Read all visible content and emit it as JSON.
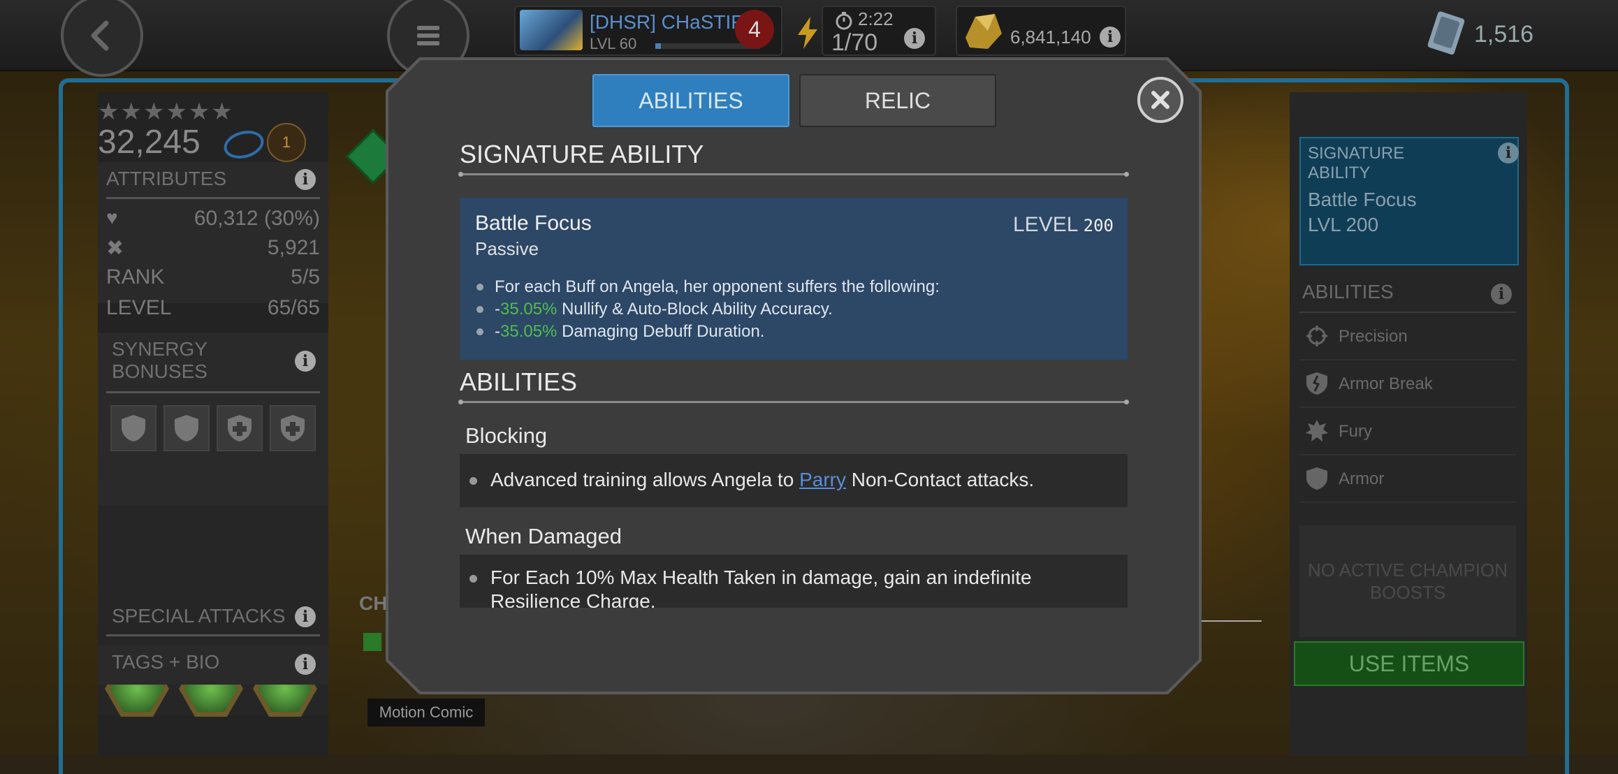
{
  "topbar": {
    "player_name": "[DHSR] CHaSTIF°",
    "player_level": "LVL 60",
    "xp_progress": 0.05,
    "notifications": "4",
    "energy_timer": "2:22",
    "energy_count": "1/70",
    "gold": "6,841,140",
    "units": "1,516"
  },
  "champion": {
    "stars": "★★★★★★",
    "rating": "32,245",
    "rank_badge": "1",
    "attributes_header": "ATTRIBUTES",
    "health": "60,312",
    "health_pct": "30%",
    "attack": "5,921",
    "rank_label": "RANK",
    "rank_value": "5/5",
    "level_label": "LEVEL",
    "level_value": "65/65",
    "synergy_header": "SYNERGY BONUSES",
    "special_attacks_header": "SPECIAL ATTACKS",
    "tags_header": "TAGS + BIO",
    "cha_label": "CHA",
    "motion_comic": "Motion Comic"
  },
  "right_panel": {
    "sig_title": "SIGNATURE ABILITY",
    "sig_name": "Battle Focus",
    "sig_level": "LVL 200",
    "abilities_header": "ABILITIES",
    "items": [
      {
        "label": "Precision",
        "icon": "crosshair-icon"
      },
      {
        "label": "Armor Break",
        "icon": "broken-shield-icon"
      },
      {
        "label": "Fury",
        "icon": "fury-icon"
      },
      {
        "label": "Armor",
        "icon": "shield-icon"
      }
    ],
    "no_boosts": "NO ACTIVE CHAMPION BOOSTS",
    "use_items": "USE ITEMS"
  },
  "modal": {
    "tabs": [
      {
        "label": "ABILITIES",
        "active": true
      },
      {
        "label": "RELIC",
        "active": false
      }
    ],
    "signature_header": "SIGNATURE ABILITY",
    "signature": {
      "name": "Battle Focus",
      "type": "Passive",
      "level_label": "LEVEL",
      "level_value": "200",
      "line1": "For each Buff on Angela, her opponent suffers the following:",
      "line2_prefix": "-",
      "line2_value": "35.05%",
      "line2_text": " Nullify & Auto-Block Ability Accuracy.",
      "line3_prefix": "-",
      "line3_value": "35.05%",
      "line3_text": " Damaging Debuff Duration."
    },
    "abilities_header": "ABILITIES",
    "blocking_title": "Blocking",
    "blocking_pre": "Advanced training allows Angela to ",
    "blocking_link": "Parry",
    "blocking_post": " Non-Contact attacks.",
    "damaged_title": "When Damaged",
    "damaged_line1": "For Each 10% Max Health Taken in damage, gain an indefinite",
    "damaged_line2": "Resilience Charge."
  },
  "colors": {
    "accent_blue": "#2f7fbe",
    "highlight_green": "#4fbf4f",
    "frame_blue": "#1f6e95"
  }
}
